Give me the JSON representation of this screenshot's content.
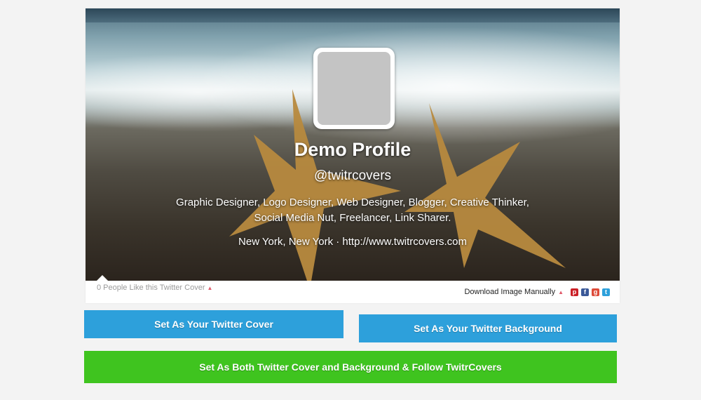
{
  "profile": {
    "name": "Demo Profile",
    "handle": "@twitrcovers",
    "bio_line1": "Graphic Designer, Logo Designer, Web Designer, Blogger, Creative Thinker,",
    "bio_line2": "Social Media Nut, Freelancer, Link Sharer.",
    "location": "New York, New York · http://www.twitrcovers.com"
  },
  "footer": {
    "likes": "0 People Like this Twitter Cover",
    "download": "Download Image Manually",
    "social_icons": [
      "pinterest-icon",
      "facebook-icon",
      "google-plus-icon",
      "twitter-icon"
    ],
    "social_colors": [
      "#cb2027",
      "#3b5998",
      "#dd4b39",
      "#2da0db"
    ]
  },
  "buttons": {
    "cover": "Set As Your Twitter Cover",
    "background": "Set As Your Twitter Background",
    "both": "Set As Both Twitter Cover and Background & Follow TwitrCovers"
  },
  "colors": {
    "blue": "#2da0db",
    "green": "#3fc41f"
  }
}
